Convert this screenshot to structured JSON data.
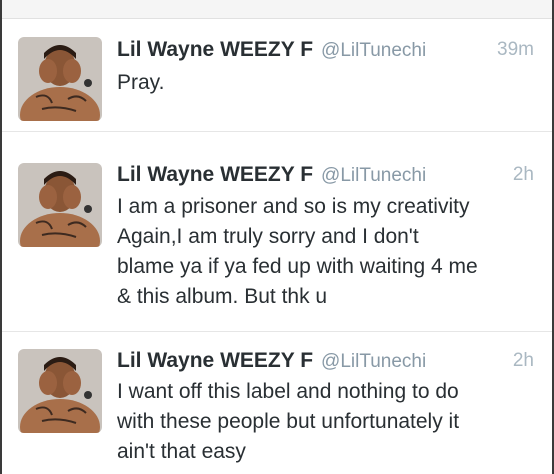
{
  "tweets": [
    {
      "name": "Lil Wayne WEEZY F",
      "handle": "@LilTunechi",
      "time": "39m",
      "lines": [
        "Pray."
      ],
      "avatar_icon": "profile-photo"
    },
    {
      "name": "Lil Wayne WEEZY F",
      "handle": "@LilTunechi",
      "time": "2h",
      "lines": [
        "I am a prisoner and so is my creativity",
        "Again,I am truly sorry and I don't",
        "blame ya if ya fed up with waiting 4 me",
        "& this album. But thk u"
      ],
      "avatar_icon": "profile-photo"
    },
    {
      "name": "Lil Wayne WEEZY F",
      "handle": "@LilTunechi",
      "time": "2h",
      "lines": [
        "I want off this label and nothing to do",
        "with these people but unfortunately it",
        "ain't that easy"
      ],
      "avatar_icon": "profile-photo"
    }
  ],
  "colors": {
    "name": "#292f33",
    "handle": "#8899a6",
    "time": "#aab8c2",
    "divider": "#e6e6e6"
  }
}
